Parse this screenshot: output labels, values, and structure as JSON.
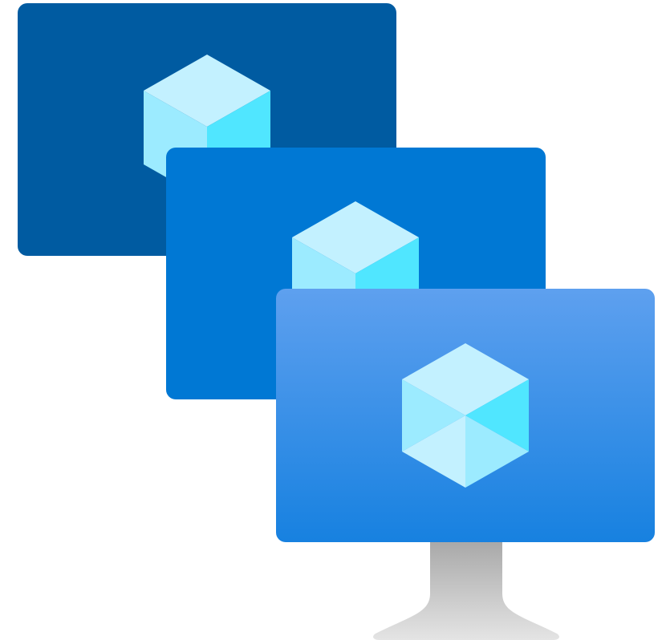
{
  "icon": {
    "name": "virtual-machine-scale-set-icon",
    "monitor_count": 3
  },
  "colors": {
    "back_screen": "#005BA1",
    "middle_screen": "#0078D4",
    "front_screen_top": "#5EA0EF",
    "front_screen_bottom": "#1781E0",
    "stand_top": "#A9A9A9",
    "stand_bottom": "#E4E4E4",
    "cube_top": "#C3F1FF",
    "cube_left": "#9CEBFF",
    "cube_right": "#50E6FF",
    "cube_bottom_left": "#C3F1FF",
    "cube_bottom_right": "#9CEBFF"
  }
}
